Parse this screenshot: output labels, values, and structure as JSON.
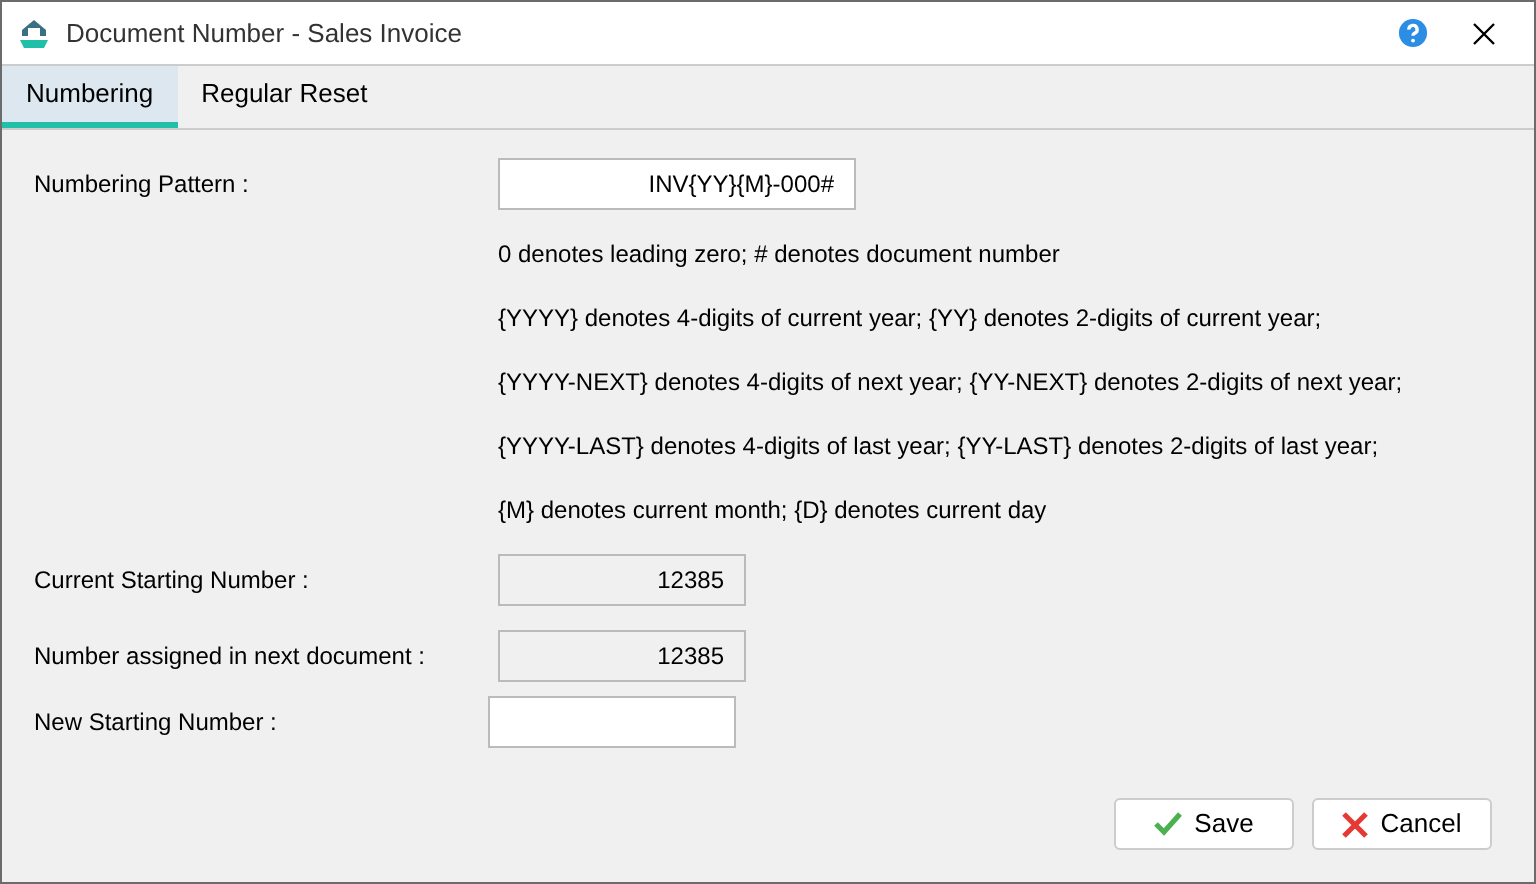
{
  "window": {
    "title": "Document Number - Sales Invoice"
  },
  "tabs": [
    {
      "label": "Numbering",
      "selected": true
    },
    {
      "label": "Regular Reset",
      "selected": false
    }
  ],
  "pattern": {
    "label": "Numbering Pattern :",
    "value": "INV{YY}{M}-000#"
  },
  "notes": [
    "0 denotes leading zero;  # denotes document number",
    "{YYYY} denotes 4-digits of current year;  {YY} denotes 2-digits of current year;",
    "{YYYY-NEXT} denotes 4-digits of next year;  {YY-NEXT} denotes 2-digits of next year;",
    "{YYYY-LAST} denotes 4-digits of last year;  {YY-LAST} denotes 2-digits of last year;",
    "{M} denotes current month;  {D} denotes current day"
  ],
  "numbers": [
    {
      "label": "Current Starting Number :",
      "value": "12385",
      "disabled": true
    },
    {
      "label": "Number assigned in next document :",
      "value": "12385",
      "disabled": true
    },
    {
      "label": "New Starting Number :",
      "disabled": false
    }
  ],
  "buttons": [
    {
      "kind": "save",
      "label": "Save"
    },
    {
      "kind": "cancel",
      "label": "Cancel"
    }
  ]
}
